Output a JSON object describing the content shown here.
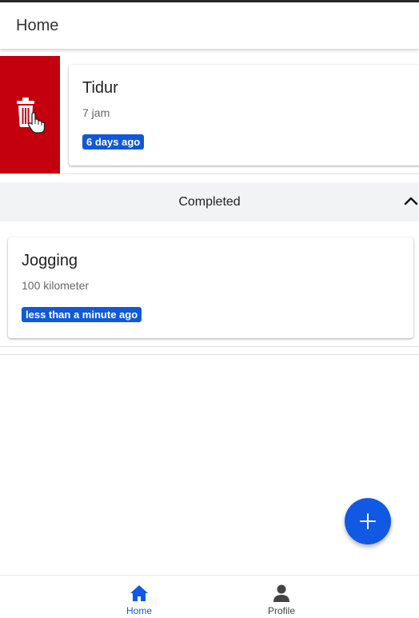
{
  "header": {
    "title": "Home"
  },
  "active_tasks": [
    {
      "name": "Tidur",
      "detail": "7 jam",
      "time": "6 days ago"
    }
  ],
  "swipe_action": {
    "icon": "trash-icon",
    "color": "#c4000e"
  },
  "completed_section": {
    "label": "Completed",
    "expanded": true
  },
  "completed_tasks": [
    {
      "name": "Jogging",
      "detail": "100 kilometer",
      "time": "less than a minute ago"
    }
  ],
  "fab": {
    "icon": "plus-icon",
    "color": "#1159e3"
  },
  "bottom_nav": {
    "items": [
      {
        "label": "Home",
        "icon": "home-icon",
        "active": true
      },
      {
        "label": "Profile",
        "icon": "person-icon",
        "active": false
      }
    ]
  },
  "colors": {
    "accent": "#1159e3",
    "danger": "#c4000e",
    "badge": "#1059d8"
  }
}
